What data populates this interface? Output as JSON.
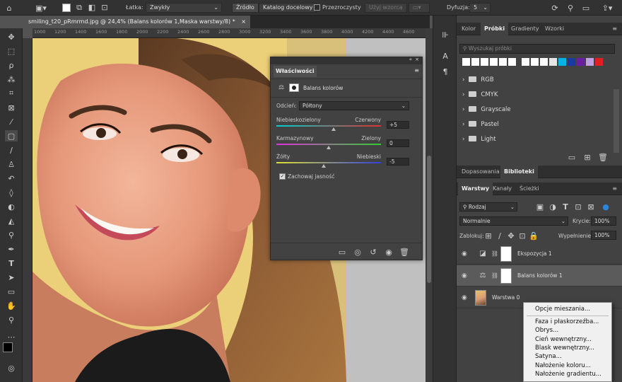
{
  "options_bar": {
    "latka_label": "Łatka:",
    "latka_value": "Zwykły",
    "zrodlo": "Źródło",
    "katalog_docelowy": "Katalog docelowy",
    "przezroczysty": "Przezroczysty",
    "uzyj_wzorca": "Użyj wzorca",
    "dyfuzja_label": "Dyfuzja:",
    "dyfuzja_value": "5"
  },
  "document": {
    "tab_title": "smiling_t20_pRmrmd.jpg @ 24,4% (Balans kolorów 1,Maska warstwy/8) *",
    "close": "×",
    "ruler_ticks": [
      "1000",
      "1200",
      "1400",
      "1600",
      "1800",
      "2000",
      "2200",
      "2400",
      "2600",
      "2800",
      "3000",
      "3200",
      "3400",
      "3600",
      "3800",
      "4000",
      "4200",
      "4400",
      "4600"
    ]
  },
  "properties": {
    "tab": "Właściwości",
    "adjustment_name": "Balans kolorów",
    "odcien_label": "Odcień:",
    "odcien_value": "Półtony",
    "sliders": [
      {
        "left": "Niebieskozielony",
        "right": "Czerwony",
        "value": "+5",
        "fraction": 0.545
      },
      {
        "left": "Karmazynowy",
        "right": "Zielony",
        "value": "0",
        "fraction": 0.5
      },
      {
        "left": "Żółty",
        "right": "Niebieski",
        "value": "-5",
        "fraction": 0.455
      }
    ],
    "preserve_luminosity": "Zachowaj jasność"
  },
  "swatches_panel": {
    "tabs": [
      "Kolor",
      "Próbki",
      "Gradienty",
      "Wzorki"
    ],
    "active_tab": "Próbki",
    "search_placeholder": "Wyszukaj próbki",
    "swatch_colors": [
      "#ffffff",
      "#ffffff",
      "#ffffff",
      "#ffffff",
      "#ffffff",
      "#ffffff",
      "#ffffff",
      "#ffffff",
      "#ffffff",
      "#e5e5e5",
      "#00b4e6",
      "#1a3aa0",
      "#6a1fa0",
      "#c0a0e0",
      "#e02020"
    ],
    "folders": [
      "RGB",
      "CMYK",
      "Grayscale",
      "Pastel",
      "Light"
    ]
  },
  "adjust_panel": {
    "tabs": [
      "Dopasowania",
      "Biblioteki"
    ],
    "active_tab": "Biblioteki"
  },
  "layers_panel": {
    "tabs": [
      "Warstwy",
      "Kanały",
      "Ścieżki"
    ],
    "active_tab": "Warstwy",
    "filter_value": "Rodzaj",
    "blend_mode": "Normalnie",
    "opacity_label": "Krycie:",
    "opacity_value": "100%",
    "lock_label": "Zablokuj:",
    "fill_label": "Wypełnienie:",
    "fill_value": "100%",
    "layers": [
      {
        "name": "Ekspozycja 1",
        "selected": false
      },
      {
        "name": "Balans kolorów 1",
        "selected": true
      },
      {
        "name": "Warstwa 0",
        "selected": false
      }
    ]
  },
  "context_menu": {
    "items": [
      "Opcje mieszania...",
      "Faza i płaskorzeźba...",
      "Obrys...",
      "Cień wewnętrzny...",
      "Blask wewnętrzny...",
      "Satyna...",
      "Nałożenie koloru...",
      "Nałożenie gradientu..."
    ]
  },
  "colors": {
    "app_bg": "#535353",
    "panel_bg": "#424242",
    "bar_bg": "#323232",
    "accent": "#2c84d8"
  }
}
